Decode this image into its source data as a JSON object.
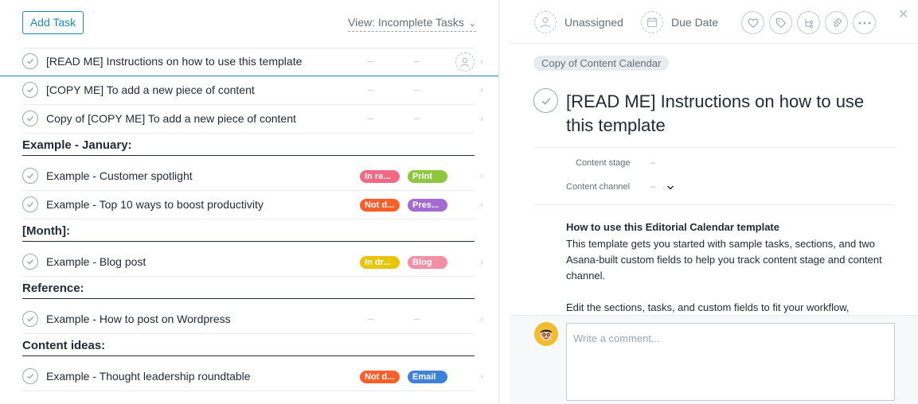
{
  "toolbar": {
    "add_task": "Add Task",
    "view": "View: Incomplete Tasks"
  },
  "tasks_top": [
    {
      "title": "[READ ME] Instructions on how to use this template",
      "v1": "–",
      "v2": "–"
    },
    {
      "title": "[COPY ME] To add a new piece of content",
      "v1": "–",
      "v2": "–"
    },
    {
      "title": "Copy of [COPY ME] To add a new piece of content",
      "v1": "–",
      "v2": "–"
    }
  ],
  "sections": [
    {
      "name": "Example - January:"
    },
    {
      "name": "[Month]:"
    },
    {
      "name": "Reference:"
    },
    {
      "name": "Content ideas:"
    }
  ],
  "tasks_jan": [
    {
      "title": "Example - Customer spotlight",
      "tag1": "In re...",
      "tag1_color": "#f06a83",
      "tag2": "Print",
      "tag2_color": "#8dc63f"
    },
    {
      "title": "Example - Top 10 ways to boost productivity",
      "tag1": "Not d...",
      "tag1_color": "#fc5e2a",
      "tag2": "Pres...",
      "tag2_color": "#a36ad1"
    }
  ],
  "tasks_month": [
    {
      "title": "Example - Blog post",
      "tag1": "In dr...",
      "tag1_color": "#e8c40a",
      "tag2": "Blog",
      "tag2_color": "#f38fa6"
    }
  ],
  "tasks_ref": [
    {
      "title": "Example - How to post on Wordpress",
      "v1": "–",
      "v2": "–"
    }
  ],
  "tasks_ideas": [
    {
      "title": "Example - Thought leadership roundtable",
      "tag1": "Not d...",
      "tag1_color": "#fc5e2a",
      "tag2": "Email",
      "tag2_color": "#3d82d8"
    }
  ],
  "detail": {
    "assignee": "Unassigned",
    "due_date": "Due Date",
    "project": "Copy of Content Calendar",
    "title": "[READ ME] Instructions on how to use this template",
    "fields": [
      {
        "label": "Content stage",
        "value": "–"
      },
      {
        "label": "Content channel",
        "value": "–"
      }
    ],
    "desc_heading": "How to use this Editorial Calendar template",
    "desc_p1": "This template gets you started with sample tasks, sections, and two Asana-built custom fields to help you track content stage and content channel.",
    "desc_p2": "Edit the sections, tasks, and custom fields to fit your workflow,",
    "comment_placeholder": "Write a comment..."
  }
}
